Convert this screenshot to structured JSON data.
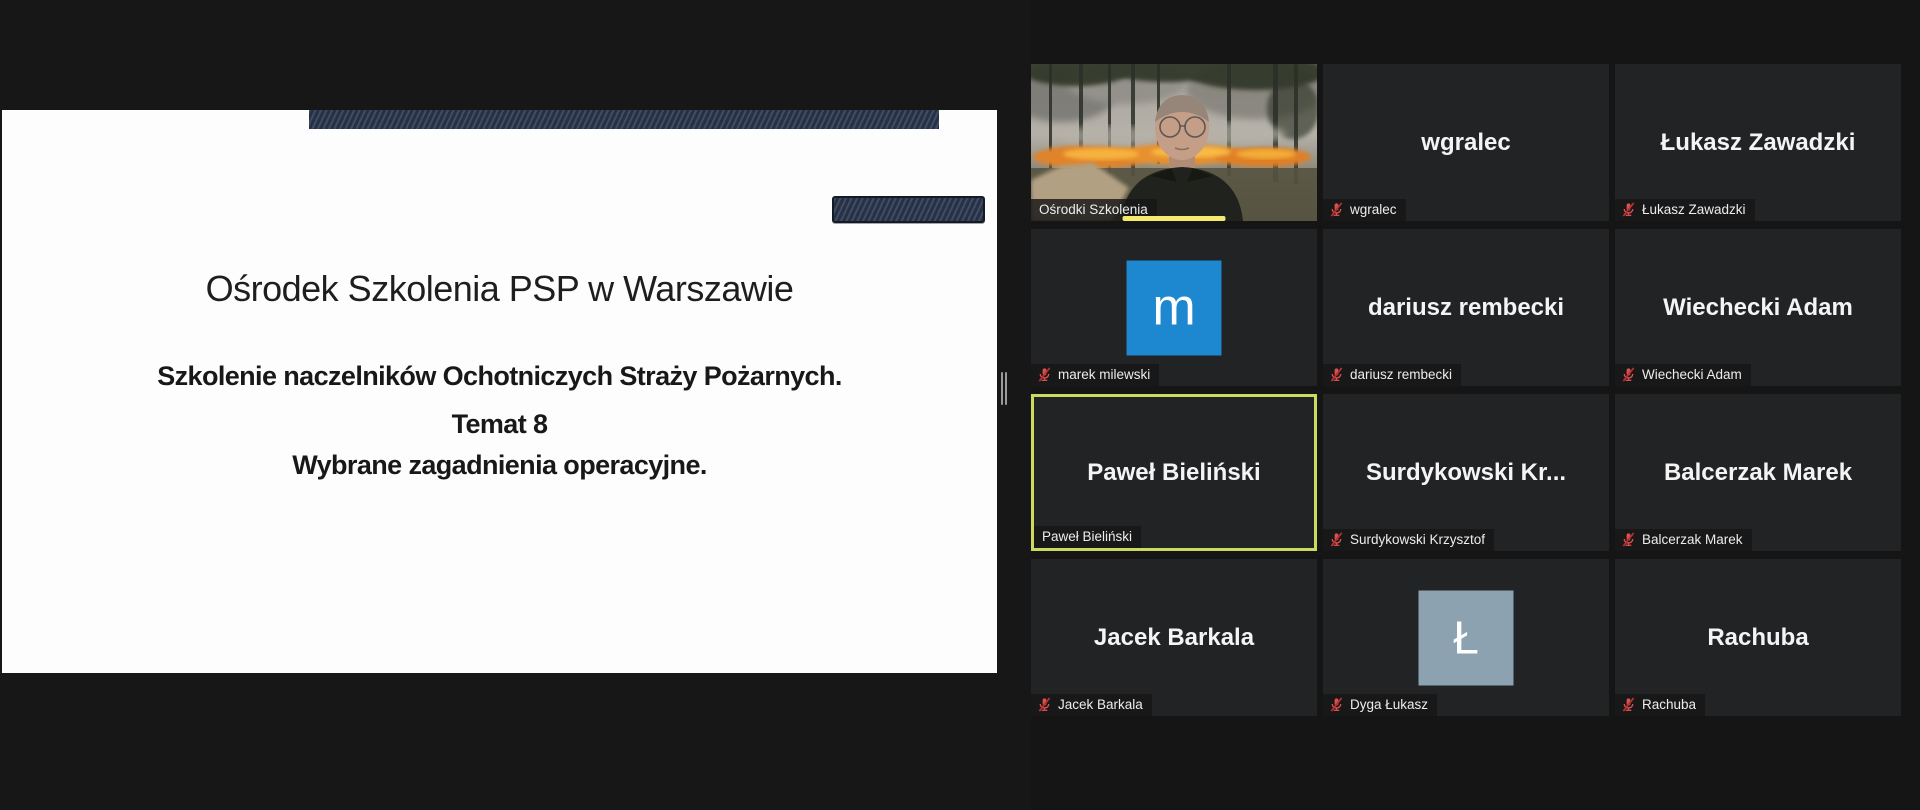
{
  "slide": {
    "title": "Ośrodek Szkolenia PSP w Warszawie",
    "line1": "Szkolenie naczelników Ochotniczych Straży Pożarnych.",
    "line2": "Temat 8",
    "line3": "Wybrane zagadnienia operacyjne."
  },
  "participants": [
    {
      "label": "Ośrodki Szkolenia",
      "muted": false,
      "type": "video",
      "camera_scene": "man-with-glasses-in-front-of-forest-fire",
      "speaking_indicator": true
    },
    {
      "display": "wgralec",
      "label": "wgralec",
      "muted": true,
      "type": "text"
    },
    {
      "display": "Łukasz Zawadzki",
      "label": "Łukasz Zawadzki",
      "muted": true,
      "type": "text"
    },
    {
      "display": "m",
      "label": "marek milewski",
      "muted": true,
      "type": "avatar",
      "avatar_color": "#1d87cf"
    },
    {
      "display": "dariusz rembecki",
      "label": "dariusz rembecki",
      "muted": true,
      "type": "text"
    },
    {
      "display": "Wiechecki Adam",
      "label": "Wiechecki Adam",
      "muted": true,
      "type": "text"
    },
    {
      "display": "Paweł Bieliński",
      "label": "Paweł Bieliński",
      "muted": false,
      "type": "text",
      "active_speaker": true
    },
    {
      "display": "Surdykowski Kr...",
      "label": "Surdykowski Krzysztof",
      "muted": true,
      "type": "text"
    },
    {
      "display": "Balcerzak Marek",
      "label": "Balcerzak Marek",
      "muted": true,
      "type": "text"
    },
    {
      "display": "Jacek Barkala",
      "label": "Jacek Barkala",
      "muted": true,
      "type": "text"
    },
    {
      "display": "Ł",
      "label": "Dyga Łukasz",
      "muted": true,
      "type": "avatar",
      "avatar_color": "#8da2b0"
    },
    {
      "display": "Rachuba",
      "label": "Rachuba",
      "muted": true,
      "type": "text"
    }
  ],
  "colors": {
    "active_speaker_border": "#ccdb60",
    "speaking_bar": "#f3ea6f",
    "muted_mic_red": "#d95150",
    "avatar_blue": "#1d87cf",
    "avatar_gray": "#8da2b0",
    "slide_accent_navy": "#2b3850"
  }
}
